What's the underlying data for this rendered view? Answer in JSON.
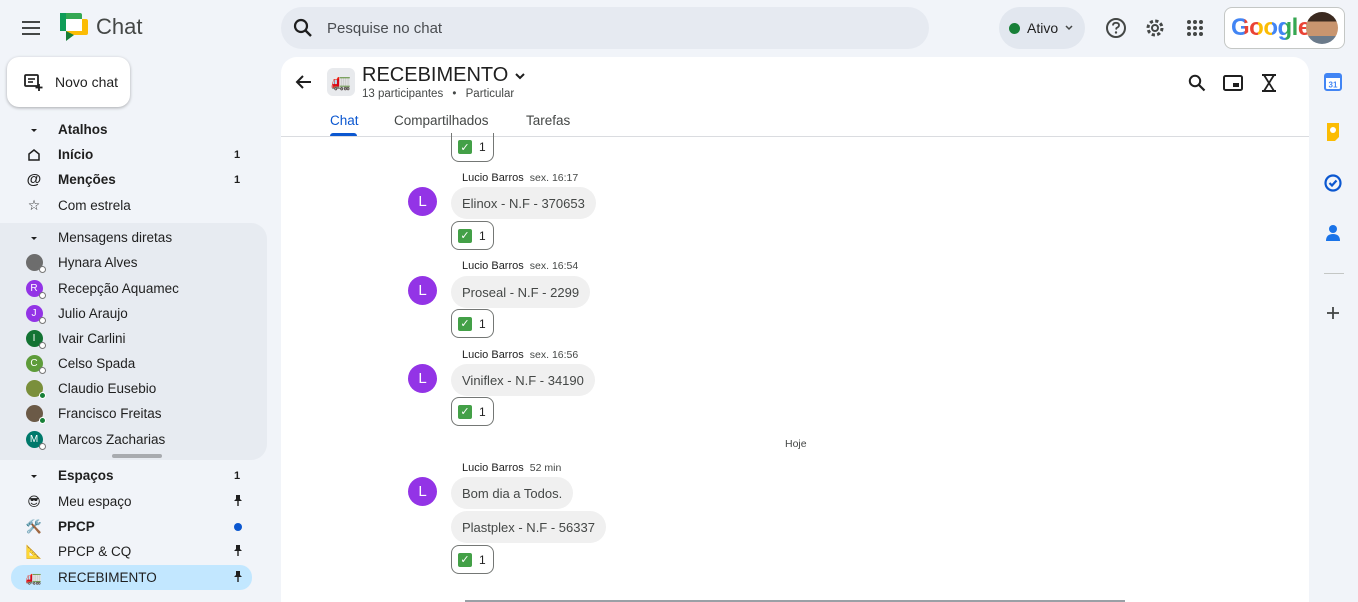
{
  "app": {
    "name": "Chat"
  },
  "search": {
    "placeholder": "Pesquise no chat"
  },
  "status": {
    "label": "Ativo",
    "color": "#188038"
  },
  "account": {
    "brand": "Google"
  },
  "sidebar": {
    "new_chat": "Novo chat",
    "shortcuts": {
      "header": "Atalhos",
      "items": [
        {
          "label": "Início",
          "count": "1",
          "icon": "home-icon"
        },
        {
          "label": "Menções",
          "count": "1",
          "icon": "at-icon"
        },
        {
          "label": "Com estrela",
          "count": "",
          "icon": "star-icon"
        }
      ]
    },
    "direct_messages": {
      "header": "Mensagens diretas",
      "items": [
        {
          "label": "Hynara Alves",
          "initial": "",
          "color": "#6d6d6d"
        },
        {
          "label": "Recepção Aquamec",
          "initial": "R",
          "color": "#9334e6"
        },
        {
          "label": "Julio Araujo",
          "initial": "J",
          "color": "#9334e6"
        },
        {
          "label": "Ivair Carlini",
          "initial": "I",
          "color": "#137333"
        },
        {
          "label": "Celso Spada",
          "initial": "C",
          "color": "#5e9c3a"
        },
        {
          "label": "Claudio Eusebio",
          "initial": "",
          "color": "#7a8f3b"
        },
        {
          "label": "Francisco Freitas",
          "initial": "",
          "color": "#6b5a47"
        },
        {
          "label": "Marcos Zacharias",
          "initial": "M",
          "color": "#00796b"
        }
      ]
    },
    "spaces": {
      "header": "Espaços",
      "count": "1",
      "items": [
        {
          "label": "Meu espaço",
          "emoji": "😎",
          "marker": "pin"
        },
        {
          "label": "PPCP",
          "emoji": "🛠️",
          "marker": "dot"
        },
        {
          "label": "PPCP & CQ",
          "emoji": "📐",
          "marker": "pin"
        },
        {
          "label": "RECEBIMENTO",
          "emoji": "🚛",
          "marker": "pin"
        }
      ]
    }
  },
  "room": {
    "title": "RECEBIMENTO",
    "participants": "13 participantes",
    "separator": "•",
    "visibility": "Particular",
    "emoji": "🚛"
  },
  "tabs": [
    {
      "label": "Chat"
    },
    {
      "label": "Compartilhados"
    },
    {
      "label": "Tarefas"
    }
  ],
  "messages": {
    "top_reaction": {
      "count": "1"
    },
    "items": [
      {
        "author": "Lucio Barros",
        "time": "sex. 16:17",
        "initial": "L",
        "text": "Elinox - N.F - 370653",
        "reaction": "1"
      },
      {
        "author": "Lucio Barros",
        "time": "sex. 16:54",
        "initial": "L",
        "text": "Proseal - N.F - 2299",
        "reaction": "1"
      },
      {
        "author": "Lucio Barros",
        "time": "sex. 16:56",
        "initial": "L",
        "text": "Viniflex - N.F - 34190",
        "reaction": "1"
      }
    ],
    "day_separator": "Hoje",
    "today": {
      "author": "Lucio Barros",
      "time": "52 min",
      "initial": "L",
      "texts": [
        "Bom dia a Todos.",
        "Plastplex - N.F - 56337"
      ],
      "reaction": "1"
    }
  }
}
